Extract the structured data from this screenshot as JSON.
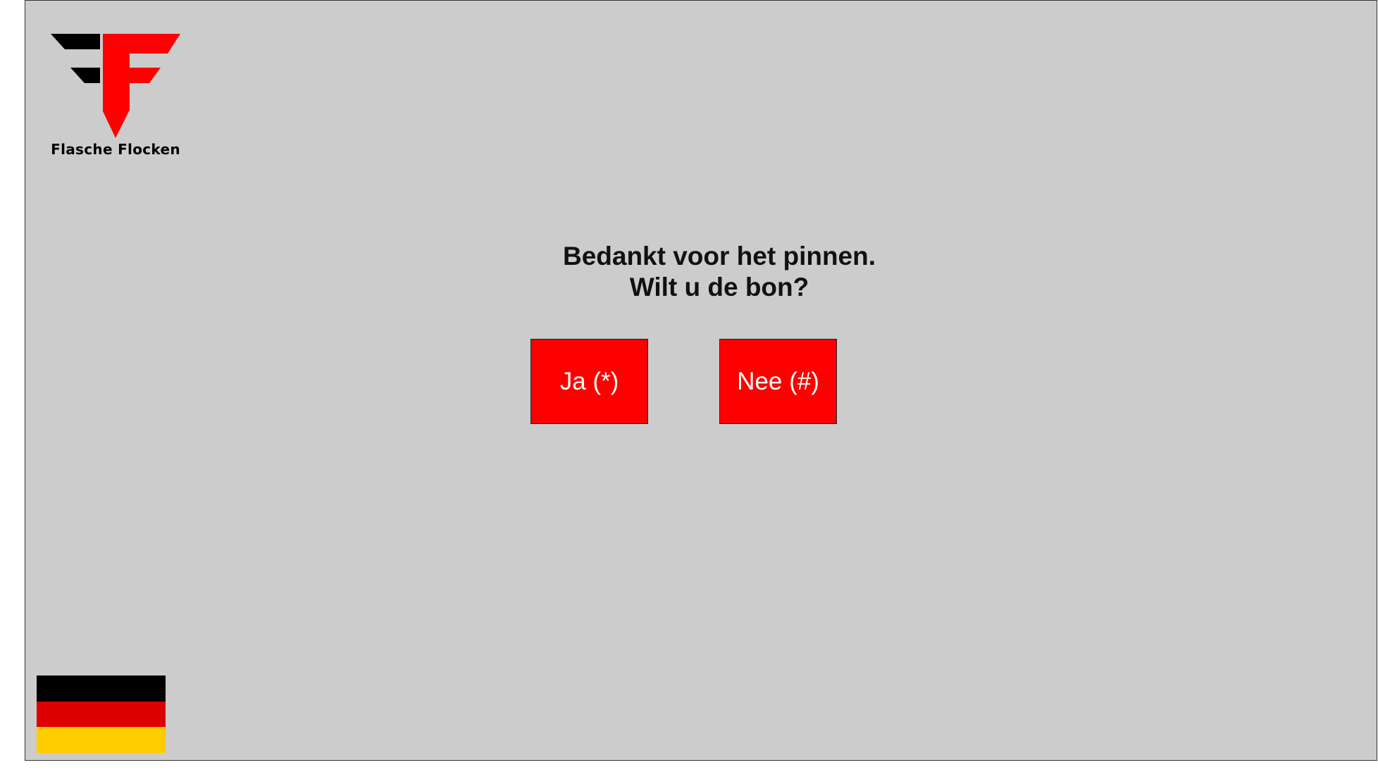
{
  "brand": {
    "name": "Flasche Flocken",
    "logo_icon": "flasche-flocken-f-logo",
    "accent_color": "#ff0000"
  },
  "prompt": {
    "line1": "Bedankt voor het pinnen.",
    "line2": "Wilt u de bon?"
  },
  "buttons": {
    "yes_label": "Ja (*)",
    "no_label": "Nee (#)",
    "color": "#ff0000"
  },
  "language": {
    "flag_icon": "german-flag-icon",
    "stripes": [
      "#000000",
      "#dd0000",
      "#ffcc00"
    ]
  }
}
